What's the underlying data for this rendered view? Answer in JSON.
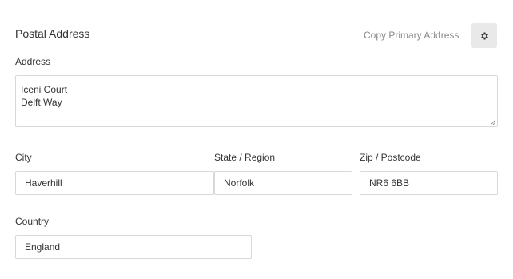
{
  "section": {
    "title": "Postal Address",
    "copy_link": "Copy Primary Address",
    "settings_icon": "gear-icon"
  },
  "address": {
    "label": "Address",
    "line1": "Iceni Court",
    "line2": "Delft Way"
  },
  "city": {
    "label": "City",
    "value": "Haverhill"
  },
  "region": {
    "label": "State / Region",
    "value": "Norfolk"
  },
  "zip": {
    "label": "Zip / Postcode",
    "value": "NR6 6BB"
  },
  "country": {
    "label": "Country",
    "value": "England"
  }
}
